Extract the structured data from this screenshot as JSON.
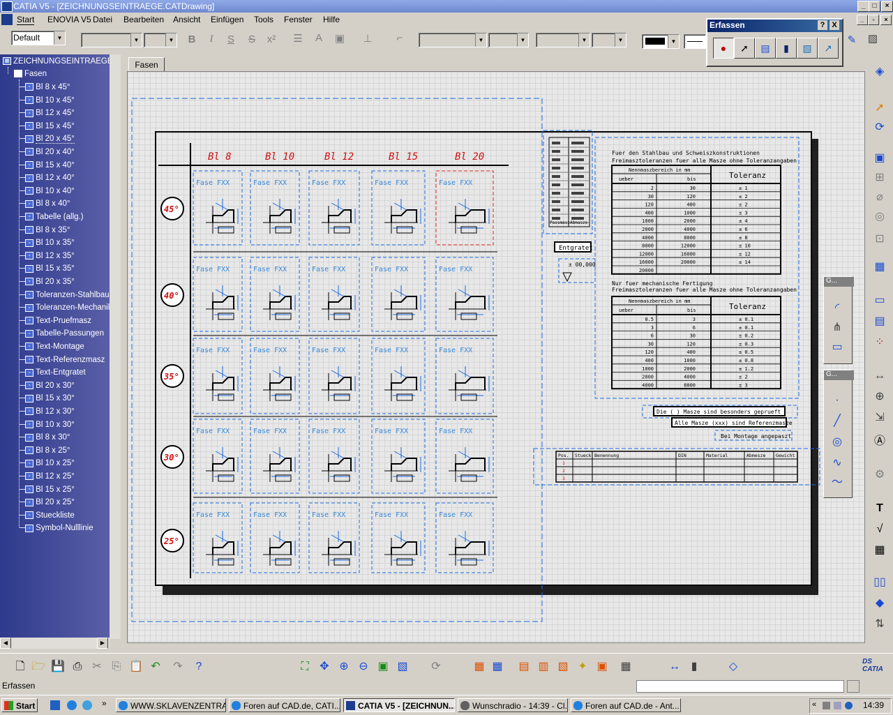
{
  "window": {
    "title": "CATIA V5 - [ZEICHNUNGSEINTRAEGE.CATDrawing]"
  },
  "menu": [
    "Start",
    "ENOVIA V5",
    "Datei",
    "Bearbeiten",
    "Ansicht",
    "Einfügen",
    "Tools",
    "Fenster",
    "Hilfe"
  ],
  "toolbar": {
    "style_value": "Default"
  },
  "erfassen": {
    "title": "Erfassen",
    "help": "?",
    "close": "X"
  },
  "tree": {
    "root": "ZEICHNUNGSEINTRAEGE",
    "sheet": "Fasen",
    "items": [
      "Bl 8 x 45°",
      "Bl 10 x 45°",
      "Bl 12 x 45°",
      "Bl 15 x 45°",
      "Bl 20 x 45°",
      "Bl 20 x 40°",
      "Bl 15 x 40°",
      "Bl 12 x 40°",
      "Bl 10 x 40°",
      "Bl 8 x 40°",
      "Tabelle (allg.)",
      "Bl 8 x 35°",
      "Bl 10 x 35°",
      "Bl 12 x 35°",
      "Bl 15 x 35°",
      "Bl 20 x 35°",
      "Toleranzen-Stahlbau",
      "Toleranzen-Mechanik",
      "Text-Pruefmasz",
      "Tabelle-Passungen",
      "Text-Montage",
      "Text-Referenzmasz",
      "Text-Entgratet",
      "Bl 20 x 30°",
      "Bl 15 x 30°",
      "Bl 12 x 30°",
      "Bl 10 x 30°",
      "Bl 8 x 30°",
      "Bl 8 x 25°",
      "Bl 10 x 25°",
      "Bl 12 x 25°",
      "Bl 15 x 25°",
      "Bl 20 x 25°",
      "Stueckliste",
      "Symbol-Nulllinie"
    ]
  },
  "tab": {
    "label": "Fasen"
  },
  "drawing": {
    "columns": [
      "Bl 8",
      "Bl 10",
      "Bl 12",
      "Bl 15",
      "Bl 20"
    ],
    "angles": [
      "45°",
      "40°",
      "35°",
      "30°",
      "25°"
    ],
    "cell_title": "Fase FXX",
    "entgratet": "Entgratet",
    "zero": "± 00,000",
    "stahl_heading_1": "Fuer den Stahlbau und Schweiszkonstruktionen",
    "stahl_heading_2": "Freimasztoleranzen fuer alle Masze ohne Toleranzangaben",
    "mech_heading_1": "Nur fuer mechanische Fertigung",
    "mech_heading_2": "Freimasztoleranzen fuer alle Masze ohne Toleranzangaben",
    "tol_head_range": "Nennmaszbereich in mm",
    "tol_head_over": "ueber",
    "tol_head_to": "bis",
    "tol_head_tol": "Toleranz",
    "stahl_rows": [
      [
        "2",
        "30",
        "± 1"
      ],
      [
        "30",
        "120",
        "± 2"
      ],
      [
        "120",
        "400",
        "± 2"
      ],
      [
        "400",
        "1000",
        "± 3"
      ],
      [
        "1000",
        "2000",
        "± 4"
      ],
      [
        "2000",
        "4000",
        "± 6"
      ],
      [
        "4000",
        "8000",
        "± 8"
      ],
      [
        "8000",
        "12000",
        "± 10"
      ],
      [
        "12000",
        "16000",
        "± 12"
      ],
      [
        "16000",
        "20000",
        "± 14"
      ],
      [
        "20000",
        "",
        ""
      ]
    ],
    "mech_rows": [
      [
        "0.5",
        "3",
        "± 0.1"
      ],
      [
        "3",
        "6",
        "± 0.1"
      ],
      [
        "6",
        "30",
        "± 0.2"
      ],
      [
        "30",
        "120",
        "± 0.3"
      ],
      [
        "120",
        "400",
        "± 0.5"
      ],
      [
        "400",
        "1000",
        "± 0.8"
      ],
      [
        "1000",
        "2000",
        "± 1.2"
      ],
      [
        "2000",
        "4000",
        "± 2"
      ],
      [
        "4000",
        "8000",
        "± 3"
      ]
    ],
    "note_pruef": "Die (      ) Masze sind besonders geprueft",
    "note_ref": "Alle Masze (xxx) sind Referenzmasze",
    "note_montage": "Bei Montage angepaszt",
    "bom_headers": [
      "Pos.",
      "Stueck",
      "Benennung",
      "DIN",
      "Material",
      "Abmesze",
      "Gewicht"
    ],
    "bom_rows": [
      "1",
      "2",
      "3"
    ],
    "fit_headers": [
      "Passmasz",
      "Abmasze"
    ]
  },
  "status": {
    "text": "Erfassen"
  },
  "taskbar": {
    "start": "Start",
    "tasks": [
      "WWW.SKLAVENZENTRA...",
      "Foren auf CAD.de, CATI...",
      "CATIA V5 - [ZEICHNUN...",
      "Wunschradio - 14:39 - Cl...",
      "Foren auf CAD.de - Ant..."
    ],
    "clock": "14:39"
  },
  "colors": {
    "title_blue": "#0a246a",
    "tree_blue": "#2e3a8c",
    "dim_blue": "#1a6ae0",
    "red": "#d01010",
    "sel_red": "#e02020"
  }
}
